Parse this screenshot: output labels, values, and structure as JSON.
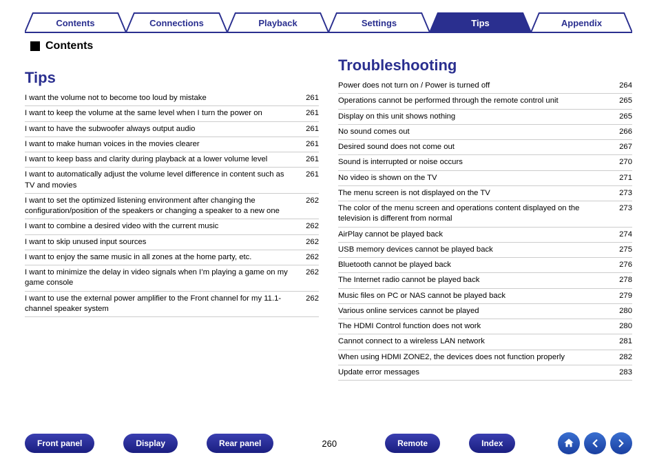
{
  "tabs": [
    {
      "label": "Contents",
      "active": false
    },
    {
      "label": "Connections",
      "active": false
    },
    {
      "label": "Playback",
      "active": false
    },
    {
      "label": "Settings",
      "active": false
    },
    {
      "label": "Tips",
      "active": true
    },
    {
      "label": "Appendix",
      "active": false
    }
  ],
  "contents_marker": "Contents",
  "left": {
    "heading": "Tips",
    "items": [
      {
        "text": "I want the volume not to become too loud by mistake",
        "page": "261"
      },
      {
        "text": "I want to keep the volume at the same level when I turn the power on",
        "page": "261"
      },
      {
        "text": "I want to have the subwoofer always output audio",
        "page": "261"
      },
      {
        "text": "I want to make human voices in the movies clearer",
        "page": "261"
      },
      {
        "text": "I want to keep bass and clarity during playback at a lower volume level",
        "page": "261"
      },
      {
        "text": "I want to automatically adjust the volume level difference in content such as TV and movies",
        "page": "261"
      },
      {
        "text": "I want to set the optimized listening environment after changing the configuration/position of the speakers or changing a speaker to a new one",
        "page": "262"
      },
      {
        "text": "I want to combine a desired video with the current music",
        "page": "262"
      },
      {
        "text": "I want to skip unused input sources",
        "page": "262"
      },
      {
        "text": "I want to enjoy the same music in all zones at the home party, etc.",
        "page": "262"
      },
      {
        "text": "I want to minimize the delay in video signals when I’m playing a game on my game console",
        "page": "262"
      },
      {
        "text": "I want to use the external power amplifier to the Front channel for my 11.1-channel speaker system",
        "page": "262"
      }
    ]
  },
  "right": {
    "heading": "Troubleshooting",
    "items": [
      {
        "text": "Power does not turn on / Power is turned off",
        "page": "264"
      },
      {
        "text": "Operations cannot be performed through the remote control unit",
        "page": "265"
      },
      {
        "text": "Display on this unit shows nothing",
        "page": "265"
      },
      {
        "text": "No sound comes out",
        "page": "266"
      },
      {
        "text": "Desired sound does not come out",
        "page": "267"
      },
      {
        "text": "Sound is interrupted or noise occurs",
        "page": "270"
      },
      {
        "text": "No video is shown on the TV",
        "page": "271"
      },
      {
        "text": "The menu screen is not displayed on the TV",
        "page": "273"
      },
      {
        "text": "The color of the menu screen and operations content displayed on the television is different from normal",
        "page": "273"
      },
      {
        "text": "AirPlay cannot be played back",
        "page": "274"
      },
      {
        "text": "USB memory devices cannot be played back",
        "page": "275"
      },
      {
        "text": "Bluetooth cannot be played back",
        "page": "276"
      },
      {
        "text": "The Internet radio cannot be played back",
        "page": "278"
      },
      {
        "text": "Music files on PC or NAS cannot be played back",
        "page": "279"
      },
      {
        "text": "Various online services cannot be played",
        "page": "280"
      },
      {
        "text": "The HDMI Control function does not work",
        "page": "280"
      },
      {
        "text": "Cannot connect to a wireless LAN network",
        "page": "281"
      },
      {
        "text": "When using HDMI ZONE2, the devices does not function properly",
        "page": "282"
      },
      {
        "text": "Update error messages",
        "page": "283"
      }
    ]
  },
  "bottom": {
    "buttons": [
      "Front panel",
      "Display",
      "Rear panel",
      "Remote",
      "Index"
    ],
    "page_number": "260"
  }
}
